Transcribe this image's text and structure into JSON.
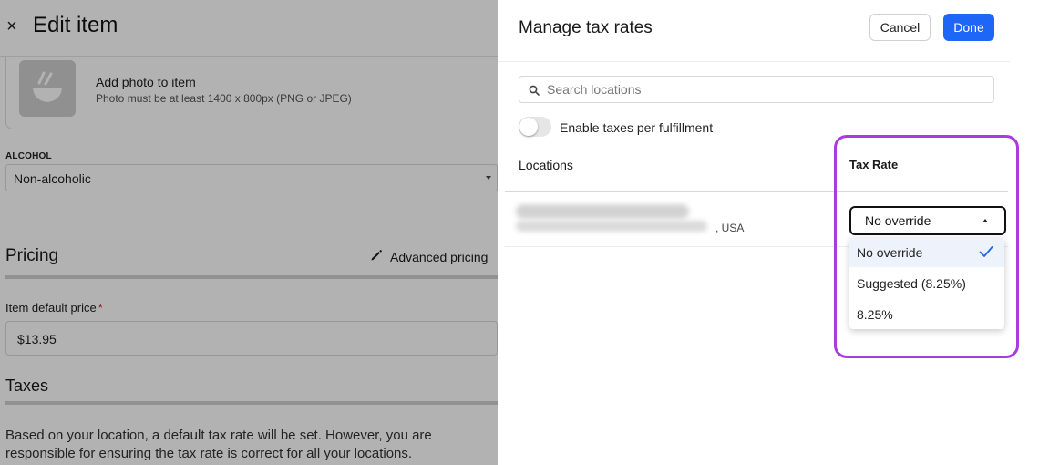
{
  "editor": {
    "close_glyph": "×",
    "title": "Edit item",
    "photo": {
      "title": "Add photo to item",
      "subtitle": "Photo must be at least 1400 x 800px (PNG or JPEG)"
    },
    "alcohol": {
      "label": "ALCOHOL",
      "value": "Non-alcoholic"
    },
    "pricing": {
      "title": "Pricing",
      "advanced_label": "Advanced pricing",
      "price_label": "Item default price",
      "required_mark": "*",
      "price_value": "$13.95"
    },
    "taxes": {
      "title": "Taxes",
      "description": "Based on your location, a default tax rate will be set. However, you are responsible for ensuring the tax rate is correct for all your locations."
    }
  },
  "panel": {
    "title": "Manage tax rates",
    "cancel_label": "Cancel",
    "done_label": "Done",
    "search_placeholder": "Search locations",
    "toggle_label": "Enable taxes per fulfillment",
    "toggle_on": false,
    "columns": {
      "locations": "Locations",
      "tax_rate": "Tax Rate"
    },
    "location_row": {
      "suffix": ", USA",
      "selected_rate": "No override"
    },
    "dropdown_options": [
      {
        "label": "No override",
        "selected": true
      },
      {
        "label": "Suggested (8.25%)",
        "selected": false
      },
      {
        "label": "8.25%",
        "selected": false
      }
    ]
  },
  "colors": {
    "primary": "#1e66f5",
    "highlight": "#a93be0",
    "check": "#1e66f5"
  }
}
